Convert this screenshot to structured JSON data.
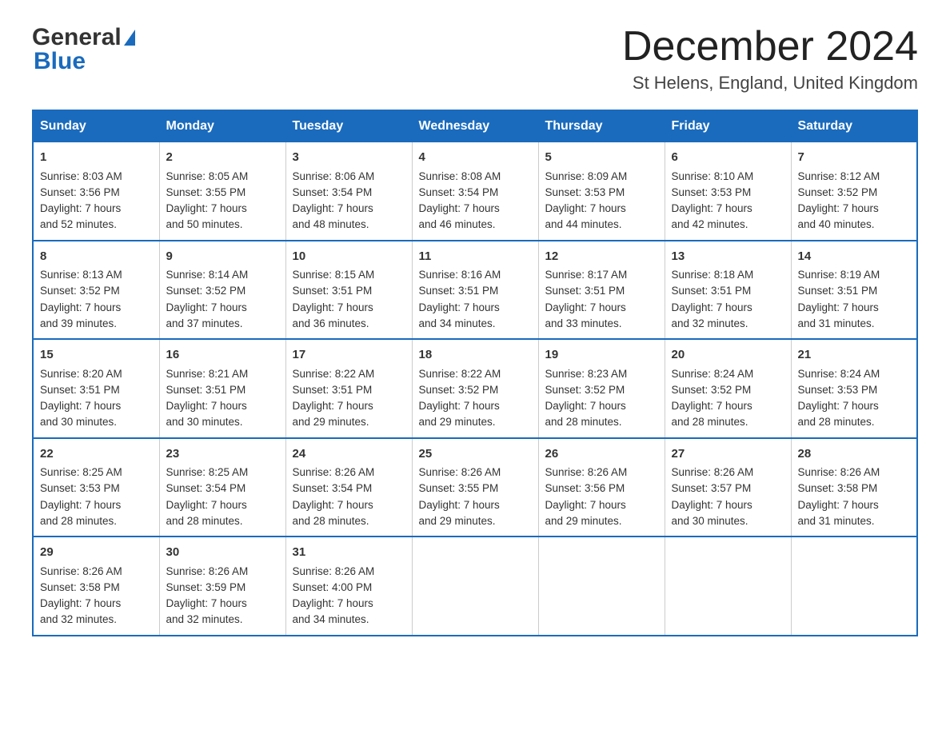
{
  "header": {
    "logo": {
      "general": "General",
      "blue": "Blue"
    },
    "title": "December 2024",
    "location": "St Helens, England, United Kingdom"
  },
  "calendar": {
    "days_of_week": [
      "Sunday",
      "Monday",
      "Tuesday",
      "Wednesday",
      "Thursday",
      "Friday",
      "Saturday"
    ],
    "weeks": [
      [
        {
          "day": "1",
          "sunrise": "8:03 AM",
          "sunset": "3:56 PM",
          "daylight": "7 hours and 52 minutes."
        },
        {
          "day": "2",
          "sunrise": "8:05 AM",
          "sunset": "3:55 PM",
          "daylight": "7 hours and 50 minutes."
        },
        {
          "day": "3",
          "sunrise": "8:06 AM",
          "sunset": "3:54 PM",
          "daylight": "7 hours and 48 minutes."
        },
        {
          "day": "4",
          "sunrise": "8:08 AM",
          "sunset": "3:54 PM",
          "daylight": "7 hours and 46 minutes."
        },
        {
          "day": "5",
          "sunrise": "8:09 AM",
          "sunset": "3:53 PM",
          "daylight": "7 hours and 44 minutes."
        },
        {
          "day": "6",
          "sunrise": "8:10 AM",
          "sunset": "3:53 PM",
          "daylight": "7 hours and 42 minutes."
        },
        {
          "day": "7",
          "sunrise": "8:12 AM",
          "sunset": "3:52 PM",
          "daylight": "7 hours and 40 minutes."
        }
      ],
      [
        {
          "day": "8",
          "sunrise": "8:13 AM",
          "sunset": "3:52 PM",
          "daylight": "7 hours and 39 minutes."
        },
        {
          "day": "9",
          "sunrise": "8:14 AM",
          "sunset": "3:52 PM",
          "daylight": "7 hours and 37 minutes."
        },
        {
          "day": "10",
          "sunrise": "8:15 AM",
          "sunset": "3:51 PM",
          "daylight": "7 hours and 36 minutes."
        },
        {
          "day": "11",
          "sunrise": "8:16 AM",
          "sunset": "3:51 PM",
          "daylight": "7 hours and 34 minutes."
        },
        {
          "day": "12",
          "sunrise": "8:17 AM",
          "sunset": "3:51 PM",
          "daylight": "7 hours and 33 minutes."
        },
        {
          "day": "13",
          "sunrise": "8:18 AM",
          "sunset": "3:51 PM",
          "daylight": "7 hours and 32 minutes."
        },
        {
          "day": "14",
          "sunrise": "8:19 AM",
          "sunset": "3:51 PM",
          "daylight": "7 hours and 31 minutes."
        }
      ],
      [
        {
          "day": "15",
          "sunrise": "8:20 AM",
          "sunset": "3:51 PM",
          "daylight": "7 hours and 30 minutes."
        },
        {
          "day": "16",
          "sunrise": "8:21 AM",
          "sunset": "3:51 PM",
          "daylight": "7 hours and 30 minutes."
        },
        {
          "day": "17",
          "sunrise": "8:22 AM",
          "sunset": "3:51 PM",
          "daylight": "7 hours and 29 minutes."
        },
        {
          "day": "18",
          "sunrise": "8:22 AM",
          "sunset": "3:52 PM",
          "daylight": "7 hours and 29 minutes."
        },
        {
          "day": "19",
          "sunrise": "8:23 AM",
          "sunset": "3:52 PM",
          "daylight": "7 hours and 28 minutes."
        },
        {
          "day": "20",
          "sunrise": "8:24 AM",
          "sunset": "3:52 PM",
          "daylight": "7 hours and 28 minutes."
        },
        {
          "day": "21",
          "sunrise": "8:24 AM",
          "sunset": "3:53 PM",
          "daylight": "7 hours and 28 minutes."
        }
      ],
      [
        {
          "day": "22",
          "sunrise": "8:25 AM",
          "sunset": "3:53 PM",
          "daylight": "7 hours and 28 minutes."
        },
        {
          "day": "23",
          "sunrise": "8:25 AM",
          "sunset": "3:54 PM",
          "daylight": "7 hours and 28 minutes."
        },
        {
          "day": "24",
          "sunrise": "8:26 AM",
          "sunset": "3:54 PM",
          "daylight": "7 hours and 28 minutes."
        },
        {
          "day": "25",
          "sunrise": "8:26 AM",
          "sunset": "3:55 PM",
          "daylight": "7 hours and 29 minutes."
        },
        {
          "day": "26",
          "sunrise": "8:26 AM",
          "sunset": "3:56 PM",
          "daylight": "7 hours and 29 minutes."
        },
        {
          "day": "27",
          "sunrise": "8:26 AM",
          "sunset": "3:57 PM",
          "daylight": "7 hours and 30 minutes."
        },
        {
          "day": "28",
          "sunrise": "8:26 AM",
          "sunset": "3:58 PM",
          "daylight": "7 hours and 31 minutes."
        }
      ],
      [
        {
          "day": "29",
          "sunrise": "8:26 AM",
          "sunset": "3:58 PM",
          "daylight": "7 hours and 32 minutes."
        },
        {
          "day": "30",
          "sunrise": "8:26 AM",
          "sunset": "3:59 PM",
          "daylight": "7 hours and 32 minutes."
        },
        {
          "day": "31",
          "sunrise": "8:26 AM",
          "sunset": "4:00 PM",
          "daylight": "7 hours and 34 minutes."
        },
        null,
        null,
        null,
        null
      ]
    ],
    "labels": {
      "sunrise": "Sunrise:",
      "sunset": "Sunset:",
      "daylight": "Daylight:"
    }
  }
}
